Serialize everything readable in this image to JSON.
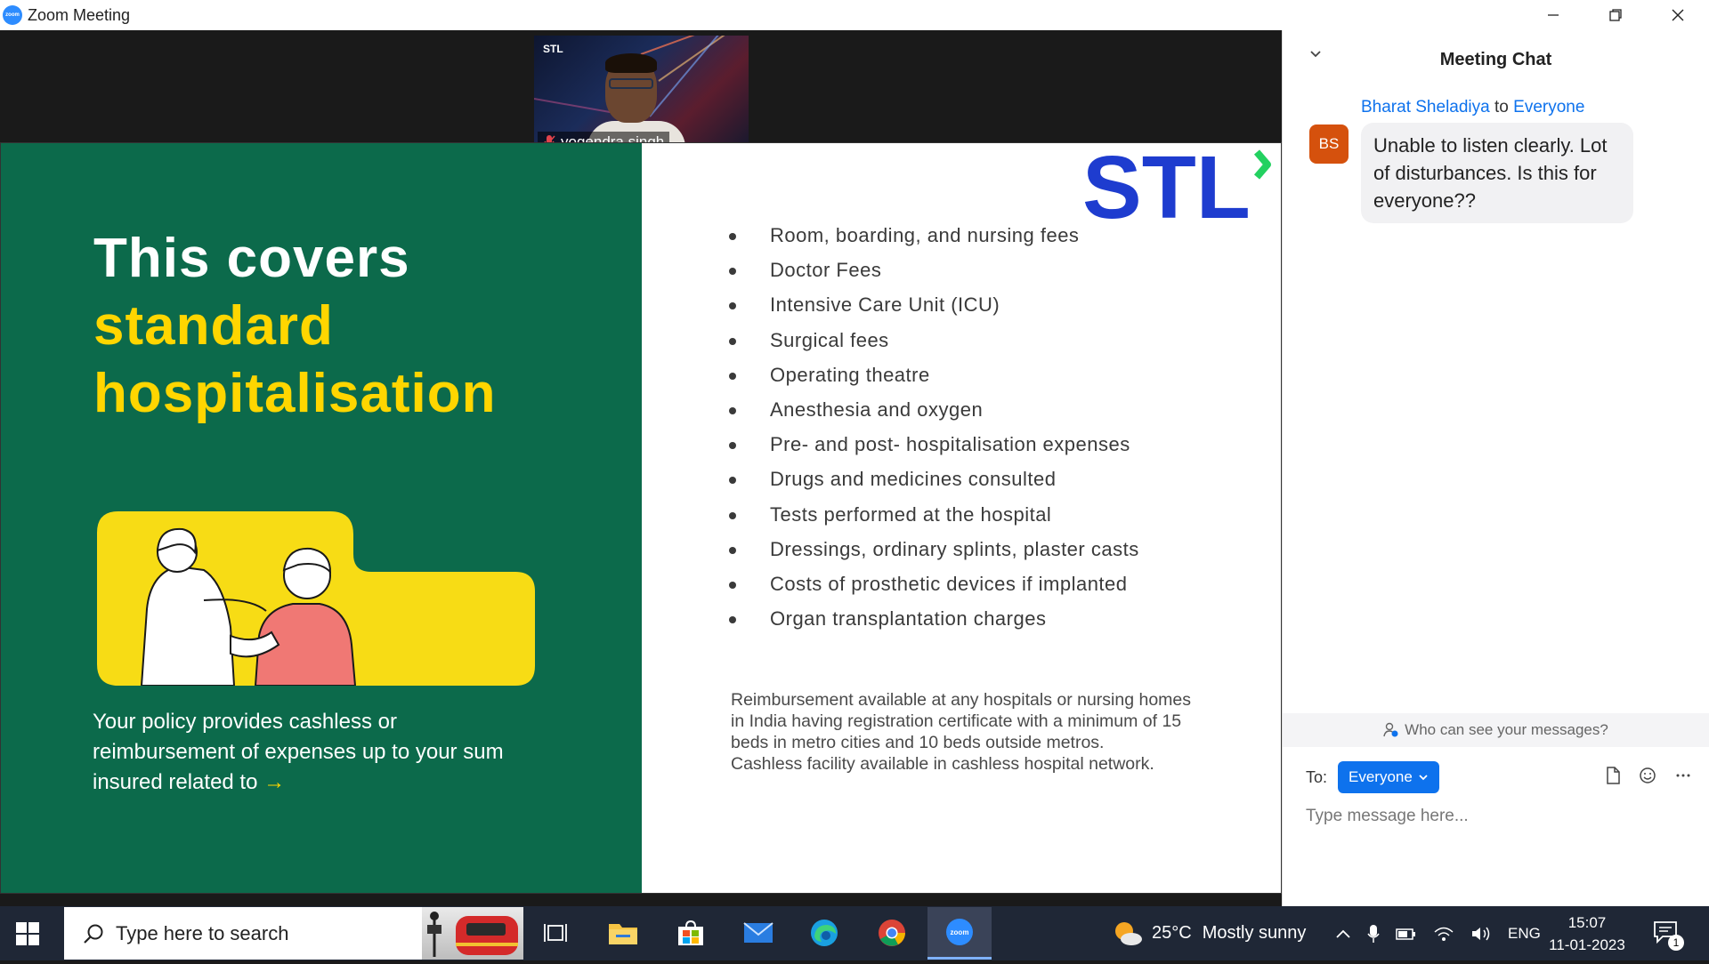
{
  "window": {
    "title": "Zoom Meeting",
    "app_icon_text": "zoom"
  },
  "video": {
    "participant_name": "yogendra.singh",
    "badge_text": "STL",
    "mic_status": "muted"
  },
  "slide": {
    "heading_line1": "This covers",
    "heading_line2": "standard",
    "heading_line3": "hospitalisation",
    "policy_text": "Your policy provides cashless or reimbursement of expenses up to your sum insured related to",
    "arrow": "→",
    "logo_text": "STL",
    "bullets": [
      "Room, boarding, and nursing fees",
      "Doctor Fees",
      "Intensive Care Unit (ICU)",
      "Surgical fees",
      "Operating theatre",
      "Anesthesia and oxygen",
      "Pre- and post- hospitalisation expenses",
      "Drugs and medicines consulted",
      "Tests performed at the hospital",
      "Dressings, ordinary splints, plaster casts",
      "Costs of prosthetic devices if implanted",
      "Organ transplantation charges"
    ],
    "reimbursement_line1": "Reimbursement available at any hospitals or nursing homes in India having registration certificate with a minimum of 15 beds in metro cities and 10 beds outside metros.",
    "reimbursement_line2": "Cashless facility available in cashless hospital network.",
    "colors": {
      "green": "#0c6a4b",
      "yellow": "#ffd600",
      "stl_blue": "#1e3ccf",
      "stl_green": "#23d160"
    }
  },
  "chat": {
    "title": "Meeting Chat",
    "message": {
      "avatar_initials": "BS",
      "sender": "Bharat Sheladiya",
      "to_word": "to",
      "recipient": "Everyone",
      "text": "Unable to listen clearly. Lot of disturbances. Is this for everyone??"
    },
    "who_can_see": "Who can see your messages?",
    "to_label": "To:",
    "to_value": "Everyone",
    "input_placeholder": "Type message here..."
  },
  "taskbar": {
    "search_placeholder": "Type here to search",
    "weather_temp": "25°C",
    "weather_text": "Mostly sunny",
    "language": "ENG",
    "time": "15:07",
    "date": "11-01-2023",
    "notification_count": "1",
    "zoom_icon_text": "zoom"
  }
}
